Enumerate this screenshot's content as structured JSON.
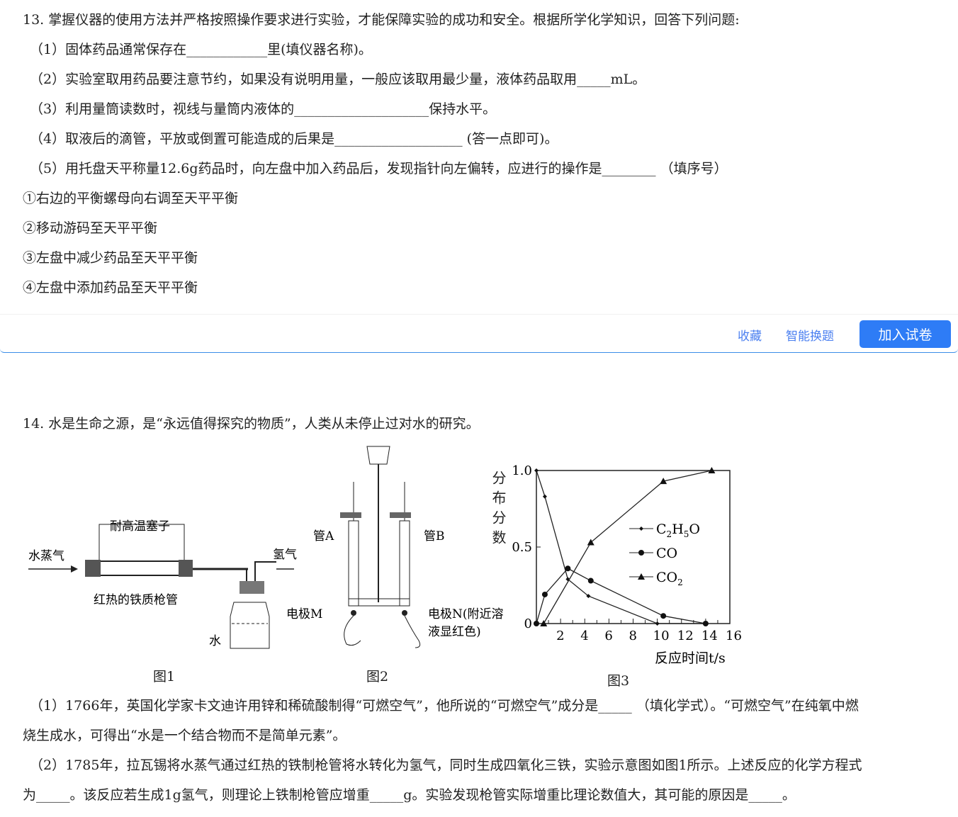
{
  "q13": {
    "stem": "13. 掌握仪器的使用方法并严格按照操作要求进行实验，才能保障实验的成功和安全。根据所学化学知识，回答下列问题:",
    "parts": [
      "（1）固体药品通常保存在____________里(填仪器名称)。",
      "（2）实验室取用药品要注意节约，如果没有说明用量，一般应该取用最少量，液体药品取用_____mL。",
      "（3）利用量筒读数时，视线与量筒内液体的____________________保持水平。",
      "（4）取液后的滴管，平放或倒置可能造成的后果是___________________ (答一点即可)。",
      "（5）用托盘天平称量12.6g药品时，向左盘中加入药品后，发现指针向左偏转，应进行的操作是________ （填序号）"
    ],
    "options": [
      "①右边的平衡螺母向右调至天平平衡",
      "②移动游码至天平平衡",
      "③左盘中减少药品至天平平衡",
      "④左盘中添加药品至天平平衡"
    ]
  },
  "actions": {
    "favorite": "收藏",
    "smart_swap": "智能换题",
    "add_to_paper": "加入试卷",
    "accent": "#2e7cf6"
  },
  "q14": {
    "stem": "14. 水是生命之源，是“永远值得探究的物质”，人类从未停止过对水的研究。",
    "fig1": {
      "caption": "图1",
      "steam": "水蒸气",
      "stopper": "耐高温塞子",
      "hydrogen": "氢气",
      "tube": "红热的铁质枪管",
      "water": "水"
    },
    "fig2": {
      "caption": "图2",
      "tubeA": "管A",
      "tubeB": "管B",
      "electrodeM": "电极M",
      "electrodeN1": "电极N(附近溶",
      "electrodeN2": "液显红色)"
    },
    "parts": [
      "（1）1766年，英国化学家卡文迪许用锌和稀硫酸制得“可燃空气”，他所说的“可燃空气”成分是_____ （填化学式）。“可燃空气”在纯氧中燃",
      "烧生成水，可得出“水是一个结合物而不是简单元素”。",
      "（2）1785年，拉瓦锡将水蒸气通过红热的铁制枪管将水转化为氢气，同时生成四氧化三铁，实验示意图如图1所示。上述反应的化学方程式",
      "为_____。该反应若生成1g氢气，则理论上铁制枪管应增重_____g。实验发现枪管实际增重比理论数值大，其可能的原因是_____。"
    ]
  },
  "chart_data": {
    "type": "line",
    "caption": "图3",
    "ylabel": "分布分数",
    "xlabel": "反应时间t/s",
    "xlim": [
      0,
      16
    ],
    "ylim": [
      0,
      1.0
    ],
    "xticks": [
      "2",
      "4",
      "6",
      "8",
      "10",
      "12",
      "14",
      "16"
    ],
    "yticks": [
      "0",
      "0.5",
      "1.0"
    ],
    "legend_position": "center-right",
    "series": [
      {
        "name": "C2H5O",
        "marker": "diamond",
        "x": [
          0,
          0.7,
          2.6,
          4.3,
          10,
          14
        ],
        "y": [
          1.0,
          0.83,
          0.29,
          0.18,
          0,
          0
        ]
      },
      {
        "name": "CO",
        "marker": "circle",
        "x": [
          0,
          0.7,
          2.6,
          4.5,
          10.5,
          14
        ],
        "y": [
          0,
          0.19,
          0.36,
          0.28,
          0.05,
          0
        ]
      },
      {
        "name": "CO2",
        "marker": "triangle",
        "x": [
          0.6,
          4.5,
          10.5,
          14.5
        ],
        "y": [
          0,
          0.53,
          0.93,
          1.0
        ]
      }
    ]
  }
}
